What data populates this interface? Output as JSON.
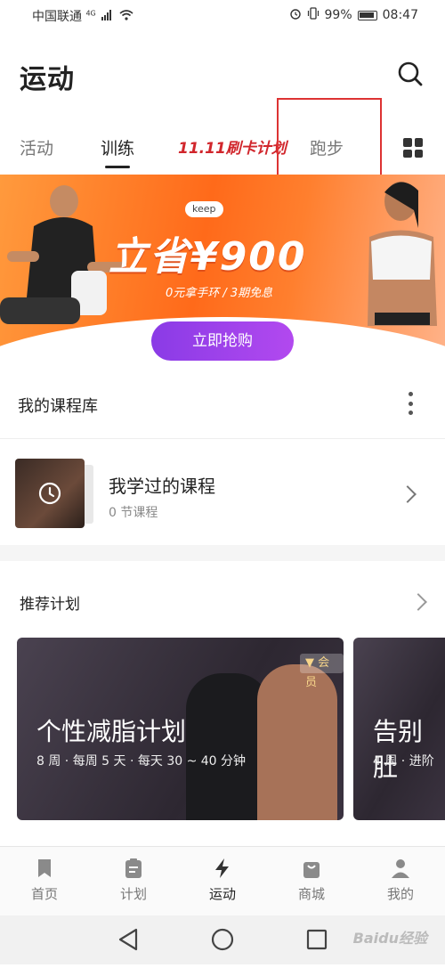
{
  "status_bar": {
    "carrier": "中国联通",
    "network": "4G",
    "battery": "99%",
    "time": "08:47"
  },
  "header": {
    "title": "运动"
  },
  "tabs": [
    {
      "label": "活动"
    },
    {
      "label": "训练"
    },
    {
      "label": "11.11刷卡计划"
    },
    {
      "label": "跑步"
    }
  ],
  "banner": {
    "brand": "keep",
    "headline": "立省¥900",
    "subline": "0元拿手环 / 3期免息",
    "button_label": "立即抢购"
  },
  "course_library": {
    "title": "我的课程库",
    "item_title": "我学过的课程",
    "item_subtitle": "0 节课程"
  },
  "recommended": {
    "title": "推荐计划",
    "cards": [
      {
        "badge": "会员",
        "title": "个性减脂计划",
        "subtitle": "8 周 · 每周 5 天 · 每天 30 ~ 40 分钟"
      },
      {
        "title": "告别肚",
        "subtitle": "4 周 · 进阶"
      }
    ]
  },
  "bottom_nav": [
    {
      "label": "首页",
      "icon": "bookmark-icon"
    },
    {
      "label": "计划",
      "icon": "clipboard-icon"
    },
    {
      "label": "运动",
      "icon": "lightning-icon",
      "active": true
    },
    {
      "label": "商城",
      "icon": "shopping-bag-icon"
    },
    {
      "label": "我的",
      "icon": "profile-icon"
    }
  ],
  "watermark": "Baidu经验"
}
